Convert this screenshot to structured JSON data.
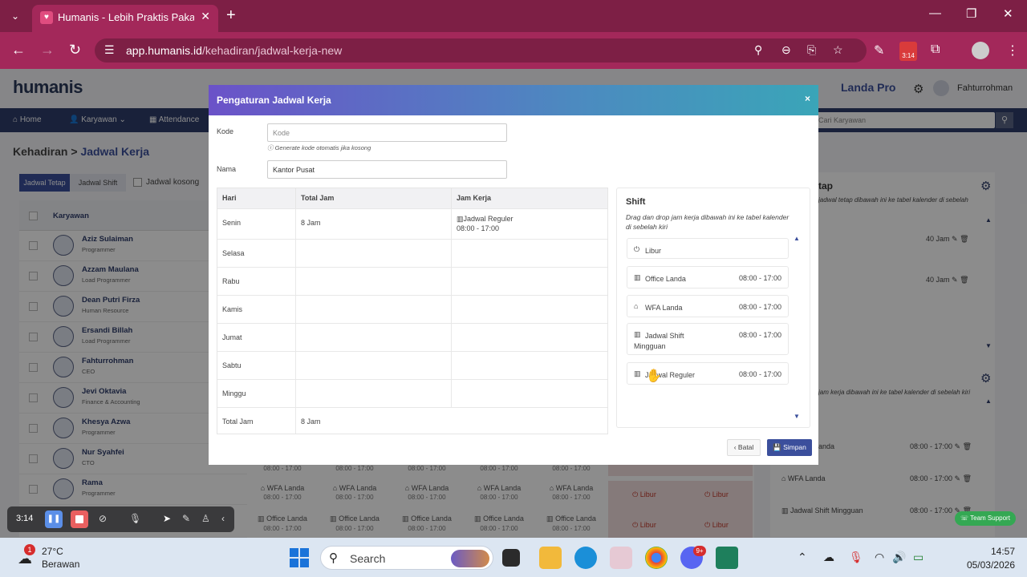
{
  "browser": {
    "tab_title": "Humanis - Lebih Praktis Pakai H",
    "url_host": "app.humanis.id",
    "url_path": "/kehadiran/jadwal-kerja-new",
    "ext_badge": "3:14",
    "accent": "#7d1f45"
  },
  "app": {
    "logo": "humanis",
    "plan": "Landa Pro",
    "user": "Fahturrohman",
    "nav": [
      "Home",
      "Karyawan",
      "Attendance"
    ],
    "search_placeholder": "Cari Karyawan",
    "breadcrumb_root": "Kehadiran",
    "breadcrumb_sep": ">",
    "breadcrumb_page": "Jadwal Kerja",
    "toggle_tetap": "Jadwal Tetap",
    "toggle_shift": "Jadwal Shift",
    "toggle_kosong": "Jadwal kosong",
    "col_karyawan": "Karyawan",
    "employees": [
      {
        "name": "Aziz Sulaiman",
        "role": "Programmer"
      },
      {
        "name": "Azzam Maulana",
        "role": "Load Programmer"
      },
      {
        "name": "Dean Putri Firza",
        "role": "Human Resource"
      },
      {
        "name": "Ersandi Billah",
        "role": "Load Programmer"
      },
      {
        "name": "Fahturrohman",
        "role": "CEO"
      },
      {
        "name": "Jevi Oktavia",
        "role": "Finance & Accounting"
      },
      {
        "name": "Khesya Azwa",
        "role": "Programmer"
      },
      {
        "name": "Nur Syahfei",
        "role": "CTO"
      },
      {
        "name": "Rama",
        "role": "Programmer"
      }
    ],
    "calendar_bottom": {
      "time": "08:00 - 17:00",
      "wfa": "WFA Landa",
      "office": "Office Landa",
      "libur": "Libur"
    },
    "right_panel": {
      "title_fragment": "tap",
      "desc1": "jadwal tetap dibawah ini ke tabel kalender di sebelah",
      "jam1": "40 Jam",
      "jam2": "40 Jam",
      "desc2": "jam kerja dibawah ini ke tabel kalender di sebelah kiri",
      "item1": "anda",
      "item1_time": "08:00 - 17:00",
      "item2": "WFA Landa",
      "item2_time": "08:00 - 17:00",
      "item3": "Jadwal Shift Mingguan",
      "item3_time": "08:00 - 17:00"
    },
    "team_support": "Team Support"
  },
  "modal": {
    "title": "Pengaturan Jadwal Kerja",
    "close": "×",
    "kode_label": "Kode",
    "kode_placeholder": "Kode",
    "kode_hint": "Generate kode otomatis jika kosong",
    "nama_label": "Nama",
    "nama_value": "Kantor Pusat",
    "table_headers": [
      "Hari",
      "Total Jam",
      "Jam Kerja"
    ],
    "days": [
      {
        "hari": "Senin",
        "total": "8 Jam",
        "jam_nama": "Jadwal Reguler",
        "jam_waktu": "08:00 - 17:00"
      },
      {
        "hari": "Selasa",
        "total": "",
        "jam_nama": "",
        "jam_waktu": ""
      },
      {
        "hari": "Rabu",
        "total": "",
        "jam_nama": "",
        "jam_waktu": ""
      },
      {
        "hari": "Kamis",
        "total": "",
        "jam_nama": "",
        "jam_waktu": ""
      },
      {
        "hari": "Jumat",
        "total": "",
        "jam_nama": "",
        "jam_waktu": ""
      },
      {
        "hari": "Sabtu",
        "total": "",
        "jam_nama": "",
        "jam_waktu": ""
      },
      {
        "hari": "Minggu",
        "total": "",
        "jam_nama": "",
        "jam_waktu": ""
      }
    ],
    "total_label": "Total Jam",
    "total_value": "8 Jam",
    "shift_title": "Shift",
    "shift_desc": "Drag dan drop jam kerja dibawah ini ke tabel kalender di sebelah kiri",
    "shifts": [
      {
        "name": "Libur",
        "time": "",
        "icon": "power-icon"
      },
      {
        "name": "Office Landa",
        "time": "08:00 - 17:00",
        "icon": "building-icon"
      },
      {
        "name": "WFA Landa",
        "time": "08:00 - 17:00",
        "icon": "home-icon"
      },
      {
        "name": "Jadwal Shift Mingguan",
        "time": "08:00 - 17:00",
        "icon": "building-icon"
      },
      {
        "name": "Jadwal Reguler",
        "time": "08:00 - 17:00",
        "icon": "building-icon"
      }
    ],
    "btn_batal": "Batal",
    "btn_simpan": "Simpan"
  },
  "recorder": {
    "time": "3:14"
  },
  "taskbar": {
    "temp": "27°C",
    "weather": "Berawan",
    "badge": "1",
    "search": "Search",
    "discord_badge": "9+",
    "time": "14:57",
    "date": "05/03/2026"
  }
}
